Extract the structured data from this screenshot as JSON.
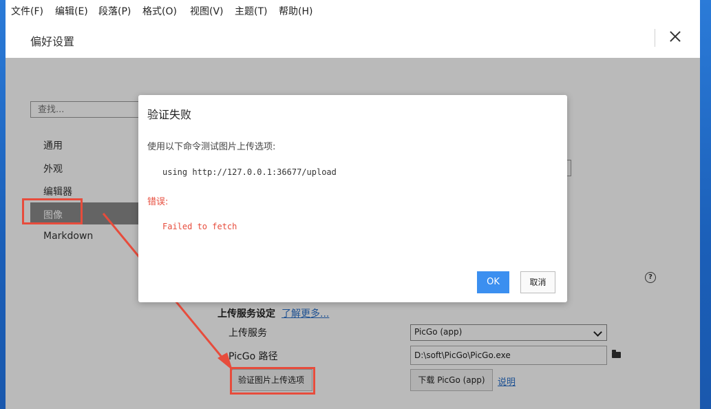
{
  "menu": [
    "文件(F)",
    "编辑(E)",
    "段落(P)",
    "格式(O)",
    "视图(V)",
    "主题(T)",
    "帮助(H)"
  ],
  "preferences": {
    "title": "偏好设置",
    "search_placeholder": "查找...",
    "sidebar": [
      "通用",
      "外观",
      "编辑器",
      "图像",
      "Markdown"
    ]
  },
  "upload_settings": {
    "header": "上传服务设定",
    "learn_more": "了解更多...",
    "service_label": "上传服务",
    "service_value": "PicGo (app)",
    "path_label": "PicGo 路径",
    "path_value": "D:\\soft\\PicGo\\PicGo.exe",
    "verify_button": "验证图片上传选项",
    "download_button": "下载 PicGo (app)",
    "explain_link": "说明"
  },
  "dialog": {
    "title": "验证失败",
    "description": "使用以下命令测试图片上传选项:",
    "command": "using http://127.0.0.1:36677/upload",
    "error_label": "错误:",
    "error_message": "Failed to fetch",
    "ok": "OK",
    "cancel": "取消"
  },
  "colors": {
    "accent": "#3b8ff0",
    "annotation_red": "#e74c3c",
    "link": "#2a6fc9"
  }
}
